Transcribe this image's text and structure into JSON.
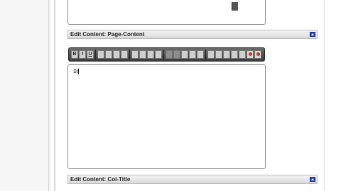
{
  "sections": {
    "page_content_title": "Edit Content: Page-Content",
    "col_title_title": "Edit Content: Col-Title"
  },
  "editor": {
    "text": "St"
  },
  "toolbar": {
    "buttons": [
      {
        "name": "bold-button",
        "label": "B"
      },
      {
        "name": "italic-button",
        "label": "I"
      },
      {
        "name": "underline-button",
        "label": "U"
      }
    ],
    "icons": [
      "align-left-icon",
      "align-center-icon",
      "align-right-icon",
      "align-justify-icon",
      "ordered-list-icon",
      "unordered-list-icon",
      "outdent-icon",
      "indent-icon",
      "text-color-icon",
      "paint-icon",
      "cut-icon",
      "copy-icon",
      "paste-icon",
      "link-icon",
      "image-icon",
      "table-icon",
      "undo-icon",
      "redo-icon",
      "spellcheck-icon",
      "help-icon"
    ]
  },
  "colors": {
    "accent": "#2b48c7",
    "toolbar_bg": "#4a4a4a",
    "section_bar": "#d9d9d9"
  }
}
